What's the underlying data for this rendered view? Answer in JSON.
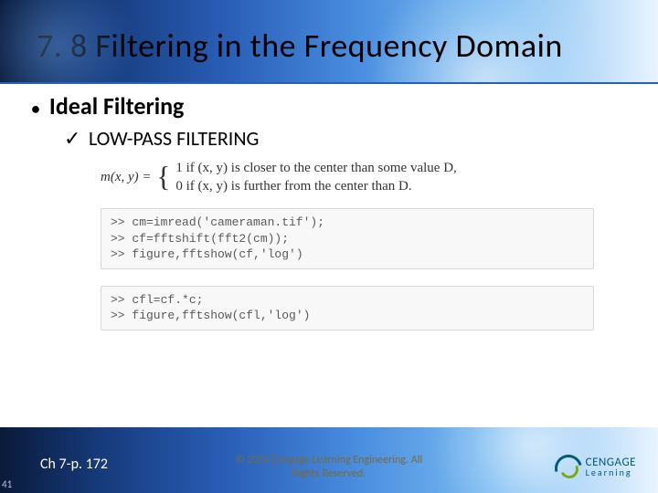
{
  "title": "7. 8 Filtering in the Frequency Domain",
  "bullet1": "Ideal Filtering",
  "bullet2": "LOW-PASS FILTERING",
  "formula": {
    "lhs": "m(x, y) = ",
    "case1": "1   if (x, y) is closer to the center than some value D,",
    "case2": "0   if (x, y) is further from the center than D."
  },
  "code1": ">> cm=imread('cameraman.tif');\n>> cf=fftshift(fft2(cm));\n>> figure,fftshow(cf,'log')",
  "code2": ">> cfl=cf.*c;\n>> figure,fftshow(cfl,'log')",
  "footer": {
    "slidenum": "41",
    "chapter": "Ch 7-p. 172",
    "copyright": "© 2010 Cengage Learning Engineering. All\nRights Reserved.",
    "logo_line1": "CENGAGE",
    "logo_line2": "Learning"
  }
}
